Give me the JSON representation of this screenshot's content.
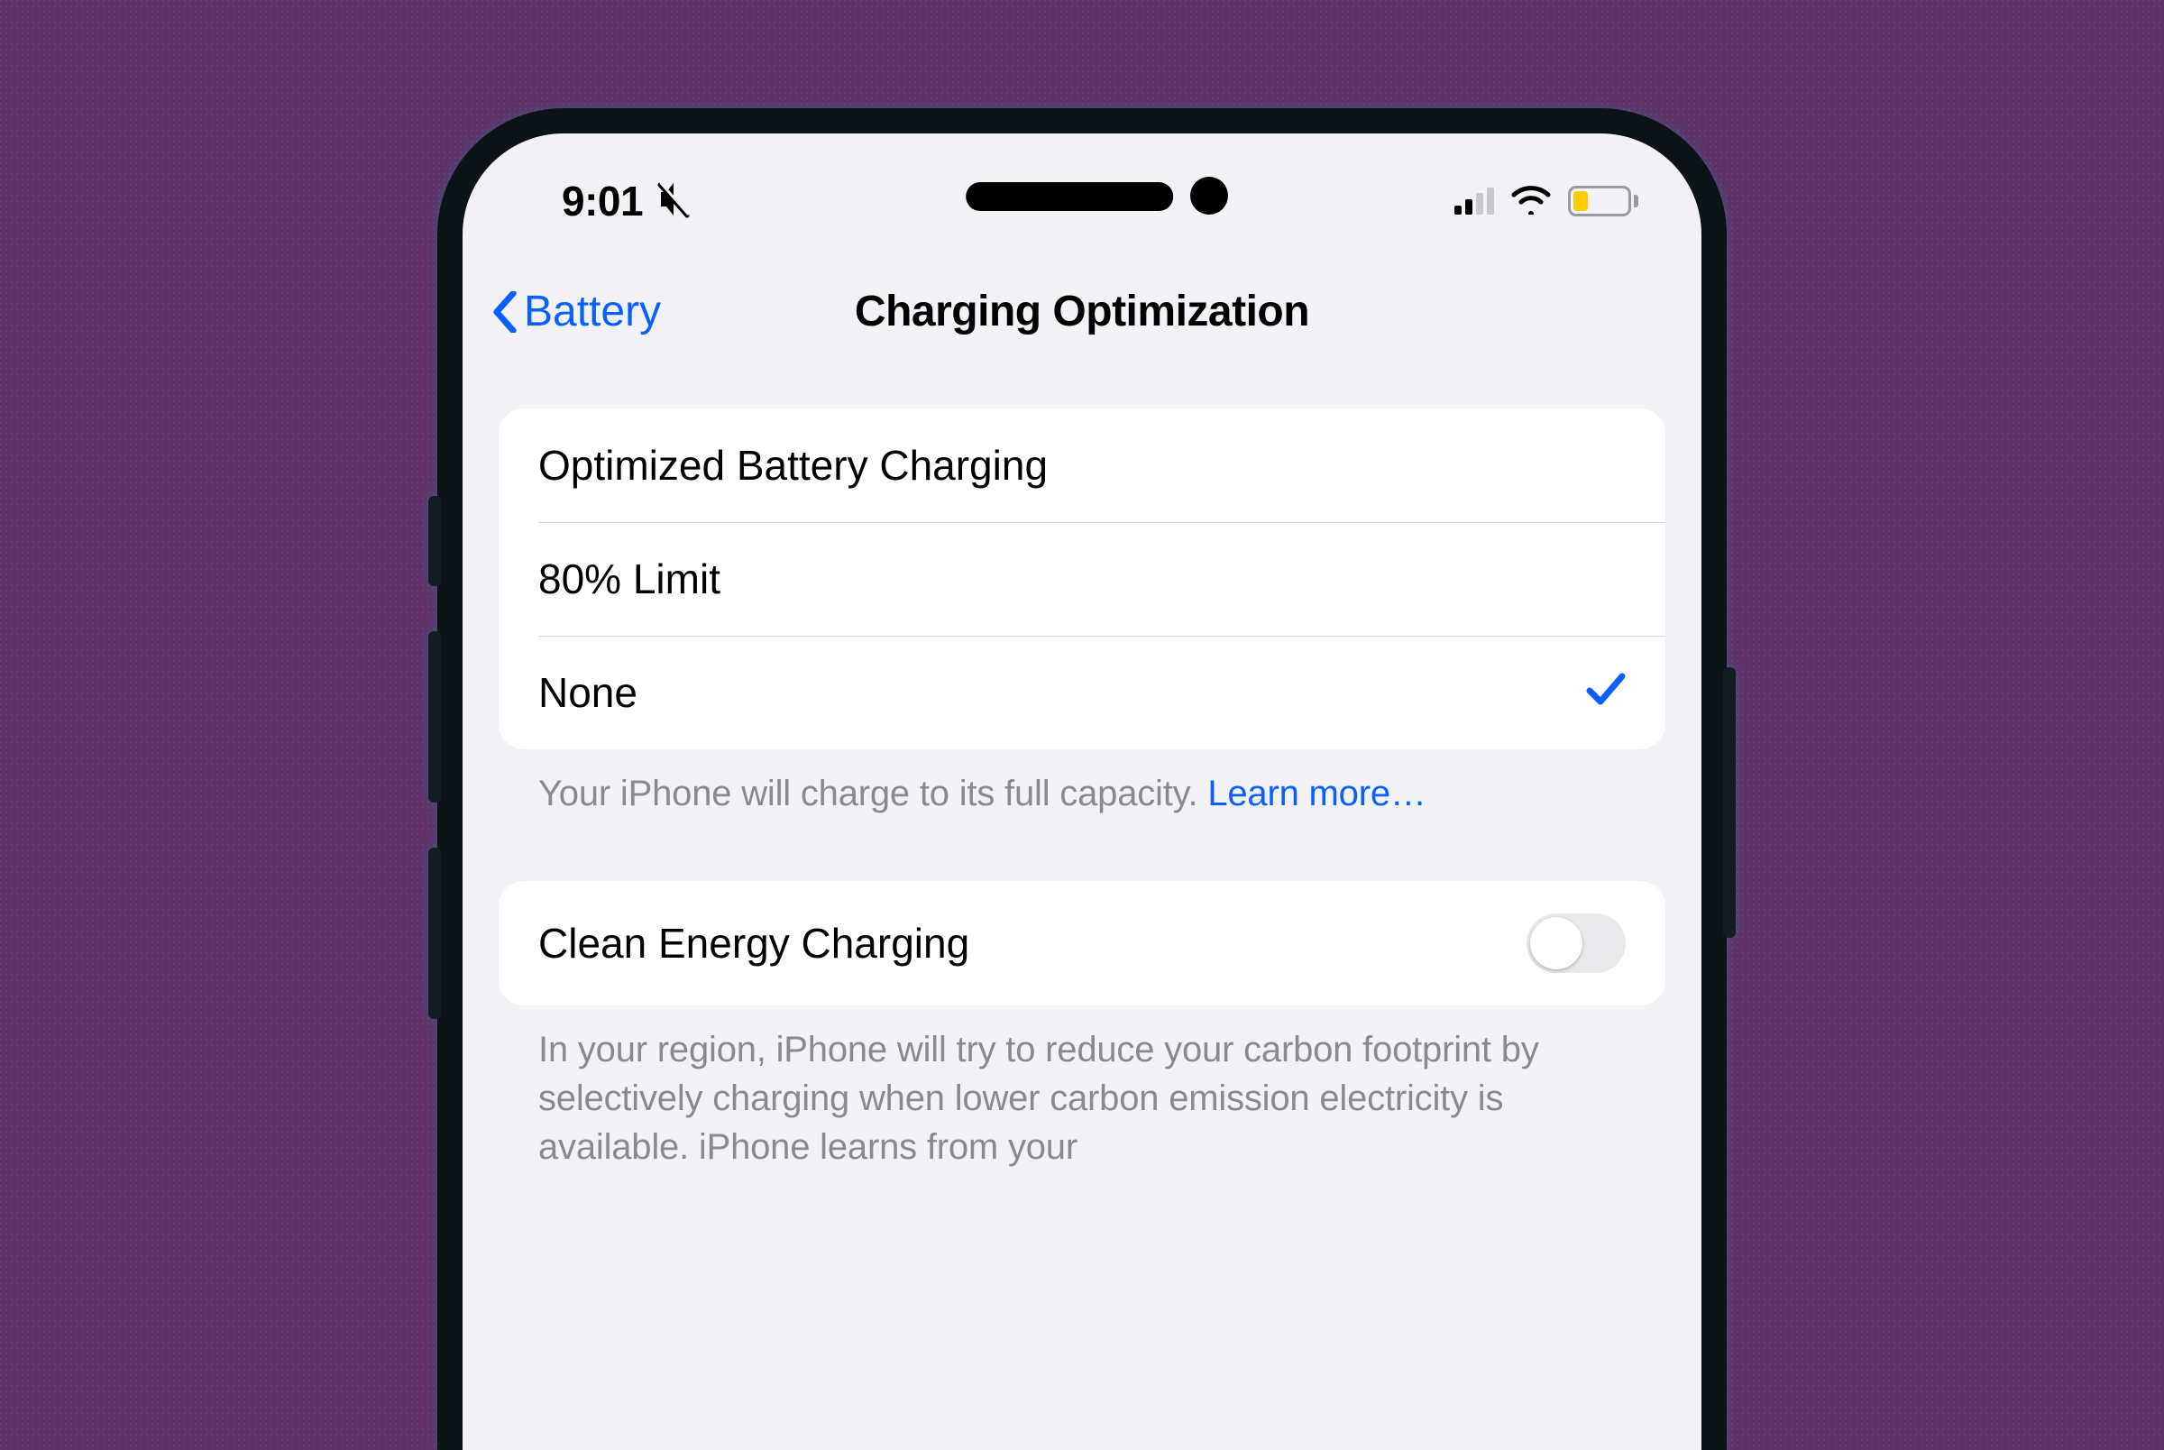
{
  "status": {
    "time": "9:01",
    "silent": true,
    "cellular_bars_active": 2,
    "cellular_bars_total": 4,
    "wifi_strength": 3,
    "battery_percent": 28,
    "battery_color": "#ffcc00"
  },
  "nav": {
    "back_label": "Battery",
    "title": "Charging Optimization"
  },
  "options": {
    "items": [
      {
        "label": "Optimized Battery Charging",
        "selected": false
      },
      {
        "label": "80% Limit",
        "selected": false
      },
      {
        "label": "None",
        "selected": true
      }
    ],
    "footer_text": "Your iPhone will charge to its full capacity. ",
    "footer_link": "Learn more…"
  },
  "clean_energy": {
    "label": "Clean Energy Charging",
    "enabled": false,
    "footer_text": "In your region, iPhone will try to reduce your carbon footprint by selectively charging when lower carbon emission electricity is available. iPhone learns from your"
  }
}
